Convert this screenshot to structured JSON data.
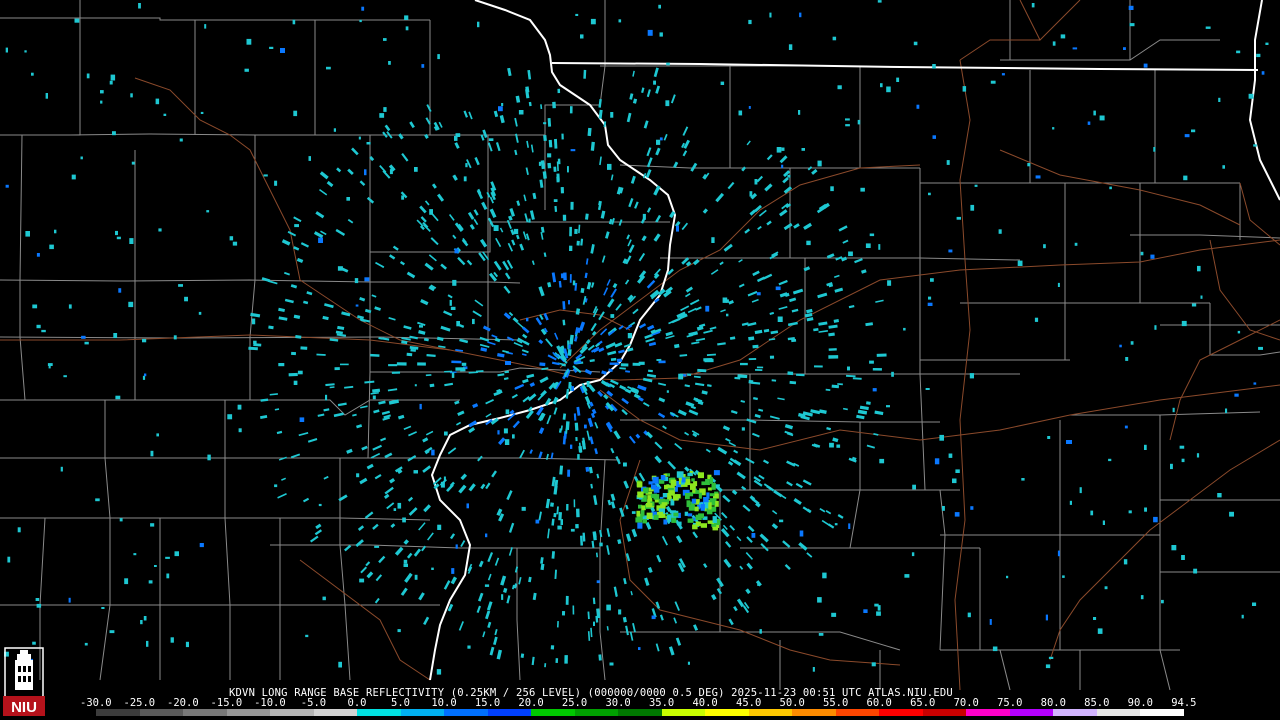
{
  "radar": {
    "header": "KDVN LONG RANGE BASE REFLECTIVITY (0.25KM / 256 LEVEL) (000000/0000 0.5 DEG) 2025-11-23 00:51 UTC  ATLAS.NIU.EDU",
    "scale_ticks": [
      "-30.0",
      "-25.0",
      "-20.0",
      "-15.0",
      "-10.0",
      "-5.0",
      "0.0",
      "5.0",
      "10.0",
      "15.0",
      "20.0",
      "25.0",
      "30.0",
      "35.0",
      "40.0",
      "45.0",
      "50.0",
      "55.0",
      "60.0",
      "65.0",
      "70.0",
      "75.0",
      "80.0",
      "85.0",
      "90.0",
      "94.5"
    ],
    "scale_colors": [
      "#3c3c3c",
      "#5a5a5a",
      "#787878",
      "#969696",
      "#b4b4b4",
      "#d2d2d2",
      "#00e0e0",
      "#00b0f0",
      "#0070ff",
      "#0040ff",
      "#00c800",
      "#00a000",
      "#007800",
      "#c8ff00",
      "#ffff00",
      "#ffc800",
      "#ff8c00",
      "#ff4600",
      "#ff0000",
      "#c80000",
      "#ff00c8",
      "#b400ff",
      "#d2b4ff",
      "#e6e6e6",
      "#ffffff"
    ]
  },
  "logo": {
    "text": "NIU",
    "colors": {
      "seal": "#b5121b",
      "outline": "#ffffff"
    }
  },
  "map_colors": {
    "state_border": "#ffffff",
    "county_line": "#8a8a8a",
    "highway": "#8b4a2b",
    "echo_light": "#1ec8d2",
    "echo_mid": "#0a78ff",
    "echo_strong": "#8ce61e"
  }
}
